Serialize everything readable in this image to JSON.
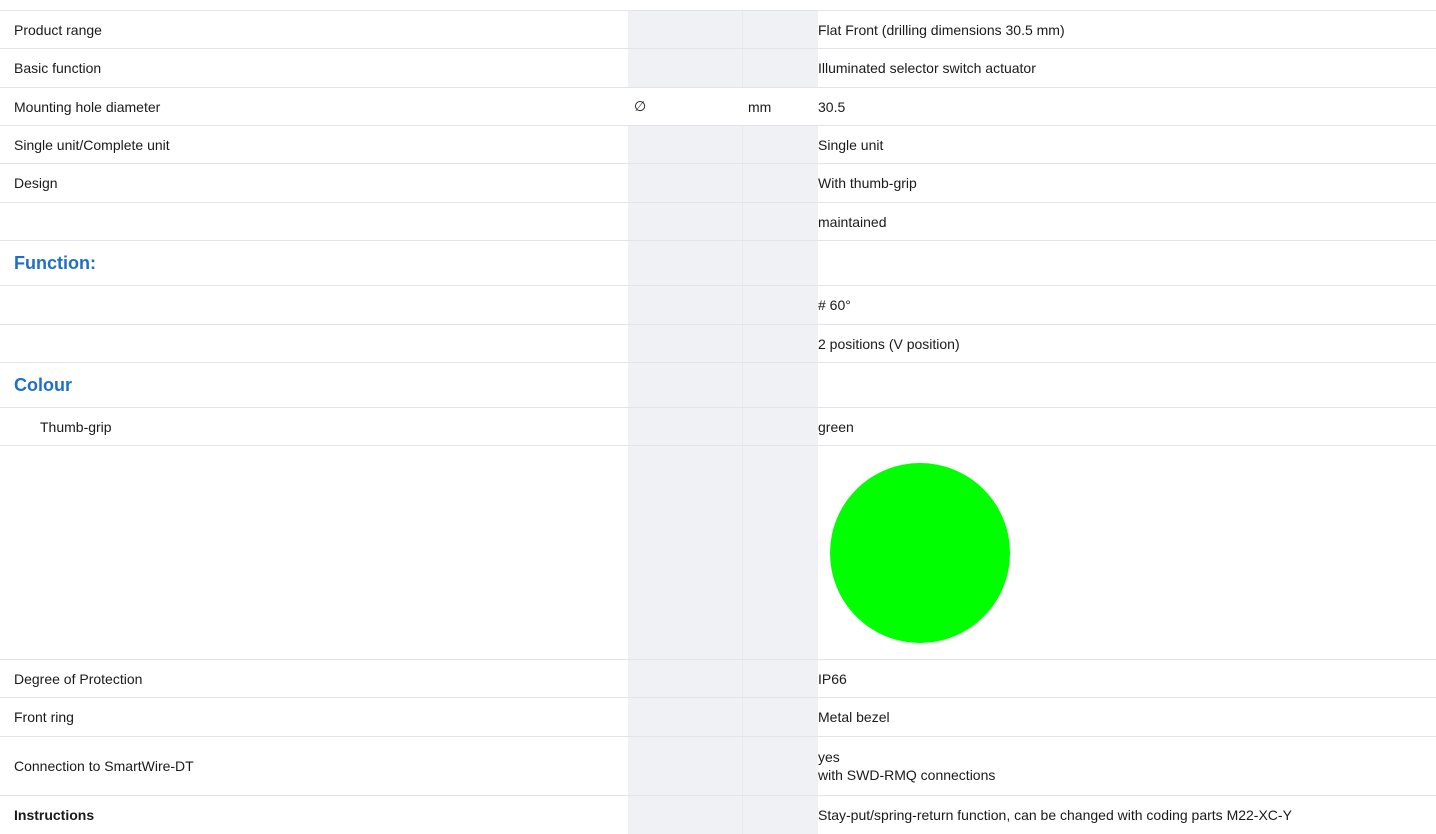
{
  "rows": {
    "product_range": {
      "label": "Product range",
      "value": "Flat Front (drilling dimensions 30.5 mm)"
    },
    "basic_function": {
      "label": "Basic function",
      "value": "Illuminated selector switch actuator"
    },
    "mounting_hole": {
      "label": "Mounting hole diameter",
      "symbol": "∅",
      "unit": "mm",
      "value": "30.5"
    },
    "single_unit": {
      "label": "Single unit/Complete unit",
      "value": "Single unit"
    },
    "design": {
      "label": "Design",
      "value": "With thumb-grip"
    },
    "design_extra": {
      "label": "",
      "value": "maintained"
    },
    "function_heading": {
      "label": "Function:"
    },
    "function_angle": {
      "label": "",
      "value": "# 60°"
    },
    "function_positions": {
      "label": "",
      "value": "2 positions (V position)"
    },
    "colour_heading": {
      "label": "Colour"
    },
    "thumb_grip": {
      "label": "Thumb-grip",
      "value": "green"
    },
    "colour_swatch": {
      "color": "#00ff00"
    },
    "degree_protection": {
      "label": "Degree of Protection",
      "value": "IP66"
    },
    "front_ring": {
      "label": "Front ring",
      "value": "Metal bezel"
    },
    "smartwire": {
      "label": "Connection to SmartWire-DT",
      "value_line1": "yes",
      "value_line2": "with SWD-RMQ connections"
    },
    "instructions": {
      "label": "Instructions",
      "value": "Stay-put/spring-return function, can be changed with coding parts M22-XC-Y"
    }
  }
}
